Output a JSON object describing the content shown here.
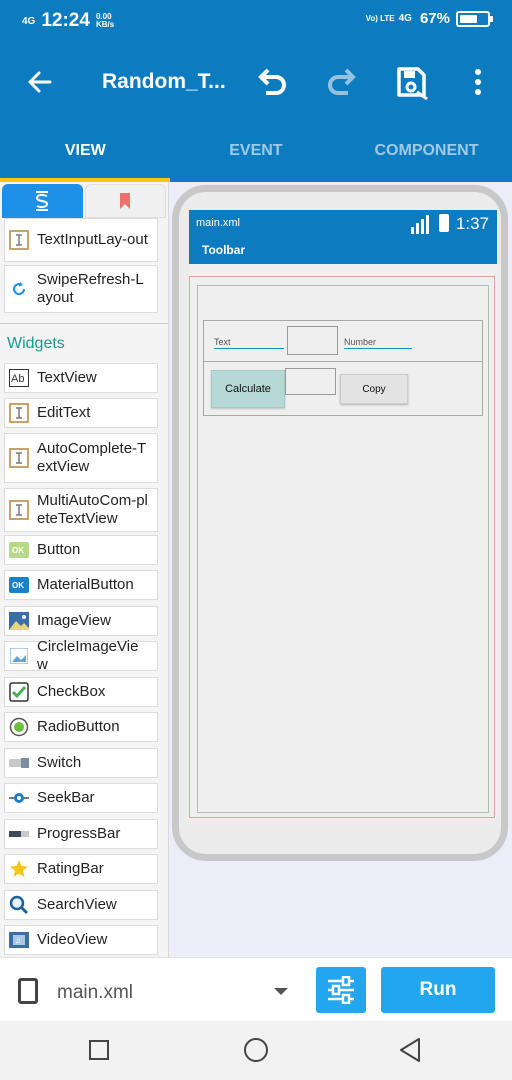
{
  "status_bar": {
    "network": "4G",
    "time": "12:24",
    "speed": "0.00 KB/s",
    "volte": "Vo) LTE",
    "network2": "4G",
    "battery": "67%",
    "battery_level": 0.67
  },
  "app_bar": {
    "title": "Random_T...",
    "icons": [
      "back-icon",
      "undo-icon",
      "redo-icon",
      "save-icon",
      "more-icon"
    ]
  },
  "tabs": [
    {
      "label": "VIEW",
      "active": true
    },
    {
      "label": "EVENT",
      "active": false
    },
    {
      "label": "COMPONENT",
      "active": false
    }
  ],
  "palette": {
    "tabs": [
      {
        "icon": "palette-icon",
        "selected": true
      },
      {
        "icon": "bookmark-icon",
        "selected": false
      }
    ],
    "layouts": [
      {
        "label": "TextInputLay-out",
        "icon": "textinput-icon"
      },
      {
        "label": "SwipeRefresh-Layout",
        "icon": "refresh-icon"
      }
    ],
    "section": "Widgets",
    "widgets": [
      {
        "label": "TextView",
        "icon": "textview-icon"
      },
      {
        "label": "EditText",
        "icon": "edittext-icon"
      },
      {
        "label": "AutoComplete-TextView",
        "icon": "edittext-icon"
      },
      {
        "label": "MultiAutoCom-pleteTextView",
        "icon": "edittext-icon"
      },
      {
        "label": "Button",
        "icon": "button-icon"
      },
      {
        "label": "MaterialButton",
        "icon": "materialbutton-icon"
      },
      {
        "label": "ImageView",
        "icon": "image-icon"
      },
      {
        "label": "CircleImageView",
        "icon": "circle-image-icon"
      },
      {
        "label": "CheckBox",
        "icon": "checkbox-icon"
      },
      {
        "label": "RadioButton",
        "icon": "radio-icon"
      },
      {
        "label": "Switch",
        "icon": "switch-icon"
      },
      {
        "label": "SeekBar",
        "icon": "seekbar-icon"
      },
      {
        "label": "ProgressBar",
        "icon": "progressbar-icon"
      },
      {
        "label": "RatingBar",
        "icon": "star-icon"
      },
      {
        "label": "SearchView",
        "icon": "search-icon"
      },
      {
        "label": "VideoView",
        "icon": "video-icon"
      }
    ]
  },
  "preview": {
    "file": "main.xml",
    "time": "1:37",
    "toolbar": "Toolbar",
    "text_hint": "Text",
    "number_hint": "Number",
    "calculate": "Calculate",
    "copy": "Copy"
  },
  "bottom_bar": {
    "file_name": "main.xml",
    "run": "Run"
  },
  "colors": {
    "primary": "#0d7bc0",
    "accent": "#22a6ee",
    "indicator": "#f5c518",
    "section": "#169e8c"
  }
}
